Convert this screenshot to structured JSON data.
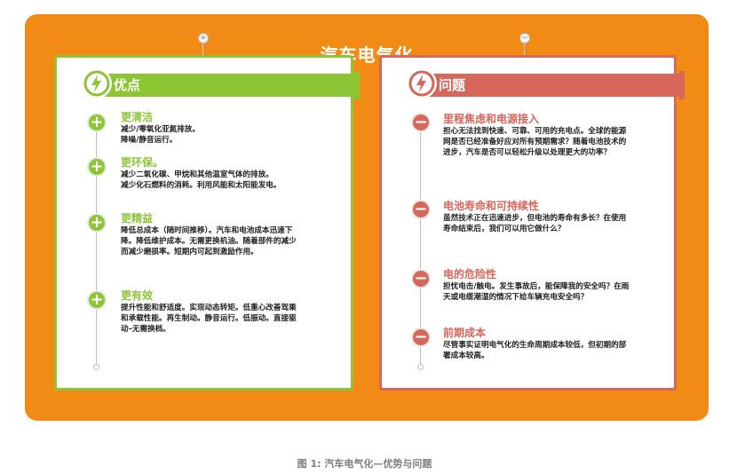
{
  "title": "汽车电气化",
  "caption": "图 1:  汽车电气化—优势与问题",
  "colors": {
    "panel": "#f28a16",
    "advantage": "#8cc634",
    "problem": "#d7665b"
  },
  "connectors": {
    "left_icon": "+",
    "right_icon": "−"
  },
  "advantages": {
    "header": "优点",
    "icon": "lightning-bolt-icon",
    "items": [
      {
        "title": "更清洁",
        "text": "减少/零氧化亚氮排放。\n降噪/静音运行。",
        "icon": "plus-icon"
      },
      {
        "title": "更环保。",
        "text": "减少二氧化碳、甲烷和其他温室气体的排放。\n减少化石燃料的消耗。利用风能和太阳能发电。",
        "icon": "plus-icon"
      },
      {
        "title": "更精益",
        "text": "降低总成本（随时间推移）。汽车和电池成本迅速下\n降。降低维护成本。无需更换机油。随着部件的减少\n而减少磨损率。短期内可起到激励作用。",
        "icon": "plus-icon"
      },
      {
        "title": "更有效",
        "text": "提升性能和舒适度。实现动态转矩。低重心改善驾乘\n和承载性能。再生制动。静音运行。低振动。直接驱\n动–无需换档。",
        "icon": "plus-icon"
      }
    ]
  },
  "problems": {
    "header": "问题",
    "icon": "lightning-bolt-icon",
    "items": [
      {
        "title": "里程焦虑和电源接入",
        "text": "担心无法找到快速、可靠、可用的充电点。全球的能源\n网是否已经准备好应对所有预期需求？随着电池技术的\n进步，汽车是否可以轻松升级以处理更大的功率？",
        "icon": "minus-icon"
      },
      {
        "title": "电池寿命和可持续性",
        "text": "虽然技术正在迅速进步，但电池的寿命有多长？在使用\n寿命结束后，我们可以用它做什么？",
        "icon": "minus-icon"
      },
      {
        "title": "电的危险性",
        "text": "担忧电击/触电。发生事故后，能保障我的安全吗？在雨\n天或电缆潮湿的情况下给车辆充电安全吗？",
        "icon": "minus-icon"
      },
      {
        "title": "前期成本",
        "text": "尽管事实证明电气化的生命周期成本较低，但初期的部\n署成本较高。",
        "icon": "minus-icon"
      }
    ]
  }
}
